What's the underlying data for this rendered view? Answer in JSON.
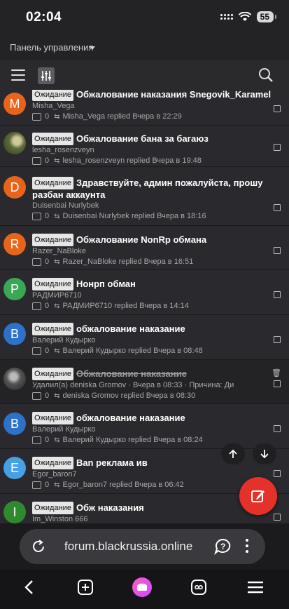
{
  "status": {
    "time": "02:04",
    "battery": "55"
  },
  "panel": {
    "label": "Панель управления"
  },
  "threads": [
    {
      "badge": "Ожидание",
      "title": "Обжалование наказания Snegovik_Karamel",
      "author": "Misha_Vega",
      "replies": "0",
      "last": "Misha_Vega replied Вчера в 22:29",
      "avatar_letter": "M",
      "avatar_color": "#e8641b"
    },
    {
      "badge": "Ожидание",
      "title": "Обжалование бана за багаюз",
      "author": "lesha_rosenzveyn",
      "replies": "0",
      "last": "lesha_rosenzveyn replied Вчера в 19:48",
      "avatar_letter": "",
      "avatar_color": ""
    },
    {
      "badge": "Ожидание",
      "title": "Здравствуйте, админ пожалуйста, прошу разбан аккаунта",
      "author": "Duisenbai Nurlybek",
      "replies": "0",
      "last": "Duisenbai Nurlybek replied Вчера в 18:16",
      "avatar_letter": "D",
      "avatar_color": "#e8641b"
    },
    {
      "badge": "Ожидание",
      "title": "Обжалование NonRp обмана",
      "author": "Razer_NaBloke",
      "replies": "0",
      "last": "Razer_NaBloke replied Вчера в 16:51",
      "avatar_letter": "R",
      "avatar_color": "#e8641b"
    },
    {
      "badge": "Ожидание",
      "title": "Нонрп обман",
      "author": "РАДМИР6710",
      "replies": "0",
      "last": "РАДМИР6710 replied Вчера в 14:14",
      "avatar_letter": "P",
      "avatar_color": "#3aa757"
    },
    {
      "badge": "Ожидание",
      "title": "обжалование наказание",
      "author": "Валерий Кудырко",
      "replies": "0",
      "last": "Валерий Кудырко replied Вчера в 08:48",
      "avatar_letter": "B",
      "avatar_color": "#2d72c8"
    },
    {
      "badge": "Ожидание",
      "title": "Обжалование наказание",
      "author": "Удалил(а) deniska Gromov · Вчера в 08:33 · Причина: Ди",
      "replies": "0",
      "last": "deniska Gromov replied Вчера в 08:30",
      "avatar_letter": "",
      "avatar_color": ""
    },
    {
      "badge": "Ожидание",
      "title": "обжалование наказание",
      "author": "Валерий Кудырко",
      "replies": "0",
      "last": "Валерий Кудырко replied Вчера в 08:24",
      "avatar_letter": "B",
      "avatar_color": "#2d72c8"
    },
    {
      "badge": "Ожидание",
      "title": "Ban реклама ив",
      "author": "Egor_baron7",
      "replies": "0",
      "last": "Egor_baron7 replied Вчера в 06:42",
      "avatar_letter": "E",
      "avatar_color": "#45a0e6"
    },
    {
      "badge": "Ожидание",
      "title": "Обж наказания",
      "author": "Im_Winston 666",
      "replies": "",
      "last": "",
      "avatar_letter": "I",
      "avatar_color": "#2f8a2f"
    }
  ],
  "browser": {
    "url": "forum.blackrussia.online"
  },
  "icons": {
    "menu": "hamburger-icon",
    "filter": "sliders-icon",
    "search": "search-icon",
    "reload": "reload-icon",
    "help": "question-bubble-icon",
    "more": "kebab-icon",
    "back": "back-icon",
    "new_tab": "plus-square-icon",
    "assistant": "alice-icon",
    "tabs": "infinity-tabs-icon",
    "hamburger_nav": "menu-icon",
    "edit": "pencil-icon",
    "trash": "trash-icon"
  }
}
